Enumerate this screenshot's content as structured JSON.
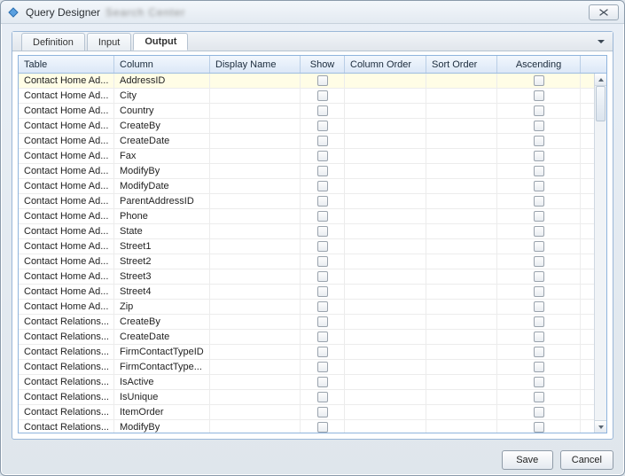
{
  "window": {
    "title": "Query Designer",
    "blurred_subtitle": "Search Center"
  },
  "tabs": [
    {
      "label": "Definition"
    },
    {
      "label": "Input"
    },
    {
      "label": "Output"
    }
  ],
  "active_tab_index": 2,
  "columns": [
    {
      "label": "Table"
    },
    {
      "label": "Column"
    },
    {
      "label": "Display Name"
    },
    {
      "label": "Show"
    },
    {
      "label": "Column Order"
    },
    {
      "label": "Sort Order"
    },
    {
      "label": "Ascending"
    }
  ],
  "rows": [
    {
      "table": "Contact Home Ad...",
      "column": "AddressID",
      "display": "",
      "show": false,
      "column_order": "",
      "sort_order": "",
      "asc": false,
      "selected": true
    },
    {
      "table": "Contact Home Ad...",
      "column": "City",
      "display": "",
      "show": false,
      "column_order": "",
      "sort_order": "",
      "asc": false
    },
    {
      "table": "Contact Home Ad...",
      "column": "Country",
      "display": "",
      "show": false,
      "column_order": "",
      "sort_order": "",
      "asc": false
    },
    {
      "table": "Contact Home Ad...",
      "column": "CreateBy",
      "display": "",
      "show": false,
      "column_order": "",
      "sort_order": "",
      "asc": false
    },
    {
      "table": "Contact Home Ad...",
      "column": "CreateDate",
      "display": "",
      "show": false,
      "column_order": "",
      "sort_order": "",
      "asc": false
    },
    {
      "table": "Contact Home Ad...",
      "column": "Fax",
      "display": "",
      "show": false,
      "column_order": "",
      "sort_order": "",
      "asc": false
    },
    {
      "table": "Contact Home Ad...",
      "column": "ModifyBy",
      "display": "",
      "show": false,
      "column_order": "",
      "sort_order": "",
      "asc": false
    },
    {
      "table": "Contact Home Ad...",
      "column": "ModifyDate",
      "display": "",
      "show": false,
      "column_order": "",
      "sort_order": "",
      "asc": false
    },
    {
      "table": "Contact Home Ad...",
      "column": "ParentAddressID",
      "display": "",
      "show": false,
      "column_order": "",
      "sort_order": "",
      "asc": false
    },
    {
      "table": "Contact Home Ad...",
      "column": "Phone",
      "display": "",
      "show": false,
      "column_order": "",
      "sort_order": "",
      "asc": false
    },
    {
      "table": "Contact Home Ad...",
      "column": "State",
      "display": "",
      "show": false,
      "column_order": "",
      "sort_order": "",
      "asc": false
    },
    {
      "table": "Contact Home Ad...",
      "column": "Street1",
      "display": "",
      "show": false,
      "column_order": "",
      "sort_order": "",
      "asc": false
    },
    {
      "table": "Contact Home Ad...",
      "column": "Street2",
      "display": "",
      "show": false,
      "column_order": "",
      "sort_order": "",
      "asc": false
    },
    {
      "table": "Contact Home Ad...",
      "column": "Street3",
      "display": "",
      "show": false,
      "column_order": "",
      "sort_order": "",
      "asc": false
    },
    {
      "table": "Contact Home Ad...",
      "column": "Street4",
      "display": "",
      "show": false,
      "column_order": "",
      "sort_order": "",
      "asc": false
    },
    {
      "table": "Contact Home Ad...",
      "column": "Zip",
      "display": "",
      "show": false,
      "column_order": "",
      "sort_order": "",
      "asc": false
    },
    {
      "table": "Contact Relations...",
      "column": "CreateBy",
      "display": "",
      "show": false,
      "column_order": "",
      "sort_order": "",
      "asc": false
    },
    {
      "table": "Contact Relations...",
      "column": "CreateDate",
      "display": "",
      "show": false,
      "column_order": "",
      "sort_order": "",
      "asc": false
    },
    {
      "table": "Contact Relations...",
      "column": "FirmContactTypeID",
      "display": "",
      "show": false,
      "column_order": "",
      "sort_order": "",
      "asc": false
    },
    {
      "table": "Contact Relations...",
      "column": "FirmContactType...",
      "display": "",
      "show": false,
      "column_order": "",
      "sort_order": "",
      "asc": false
    },
    {
      "table": "Contact Relations...",
      "column": "IsActive",
      "display": "",
      "show": false,
      "column_order": "",
      "sort_order": "",
      "asc": false
    },
    {
      "table": "Contact Relations...",
      "column": "IsUnique",
      "display": "",
      "show": false,
      "column_order": "",
      "sort_order": "",
      "asc": false
    },
    {
      "table": "Contact Relations...",
      "column": "ItemOrder",
      "display": "",
      "show": false,
      "column_order": "",
      "sort_order": "",
      "asc": false
    },
    {
      "table": "Contact Relations...",
      "column": "ModifyBy",
      "display": "",
      "show": false,
      "column_order": "",
      "sort_order": "",
      "asc": false
    }
  ],
  "buttons": {
    "save": "Save",
    "cancel": "Cancel"
  }
}
